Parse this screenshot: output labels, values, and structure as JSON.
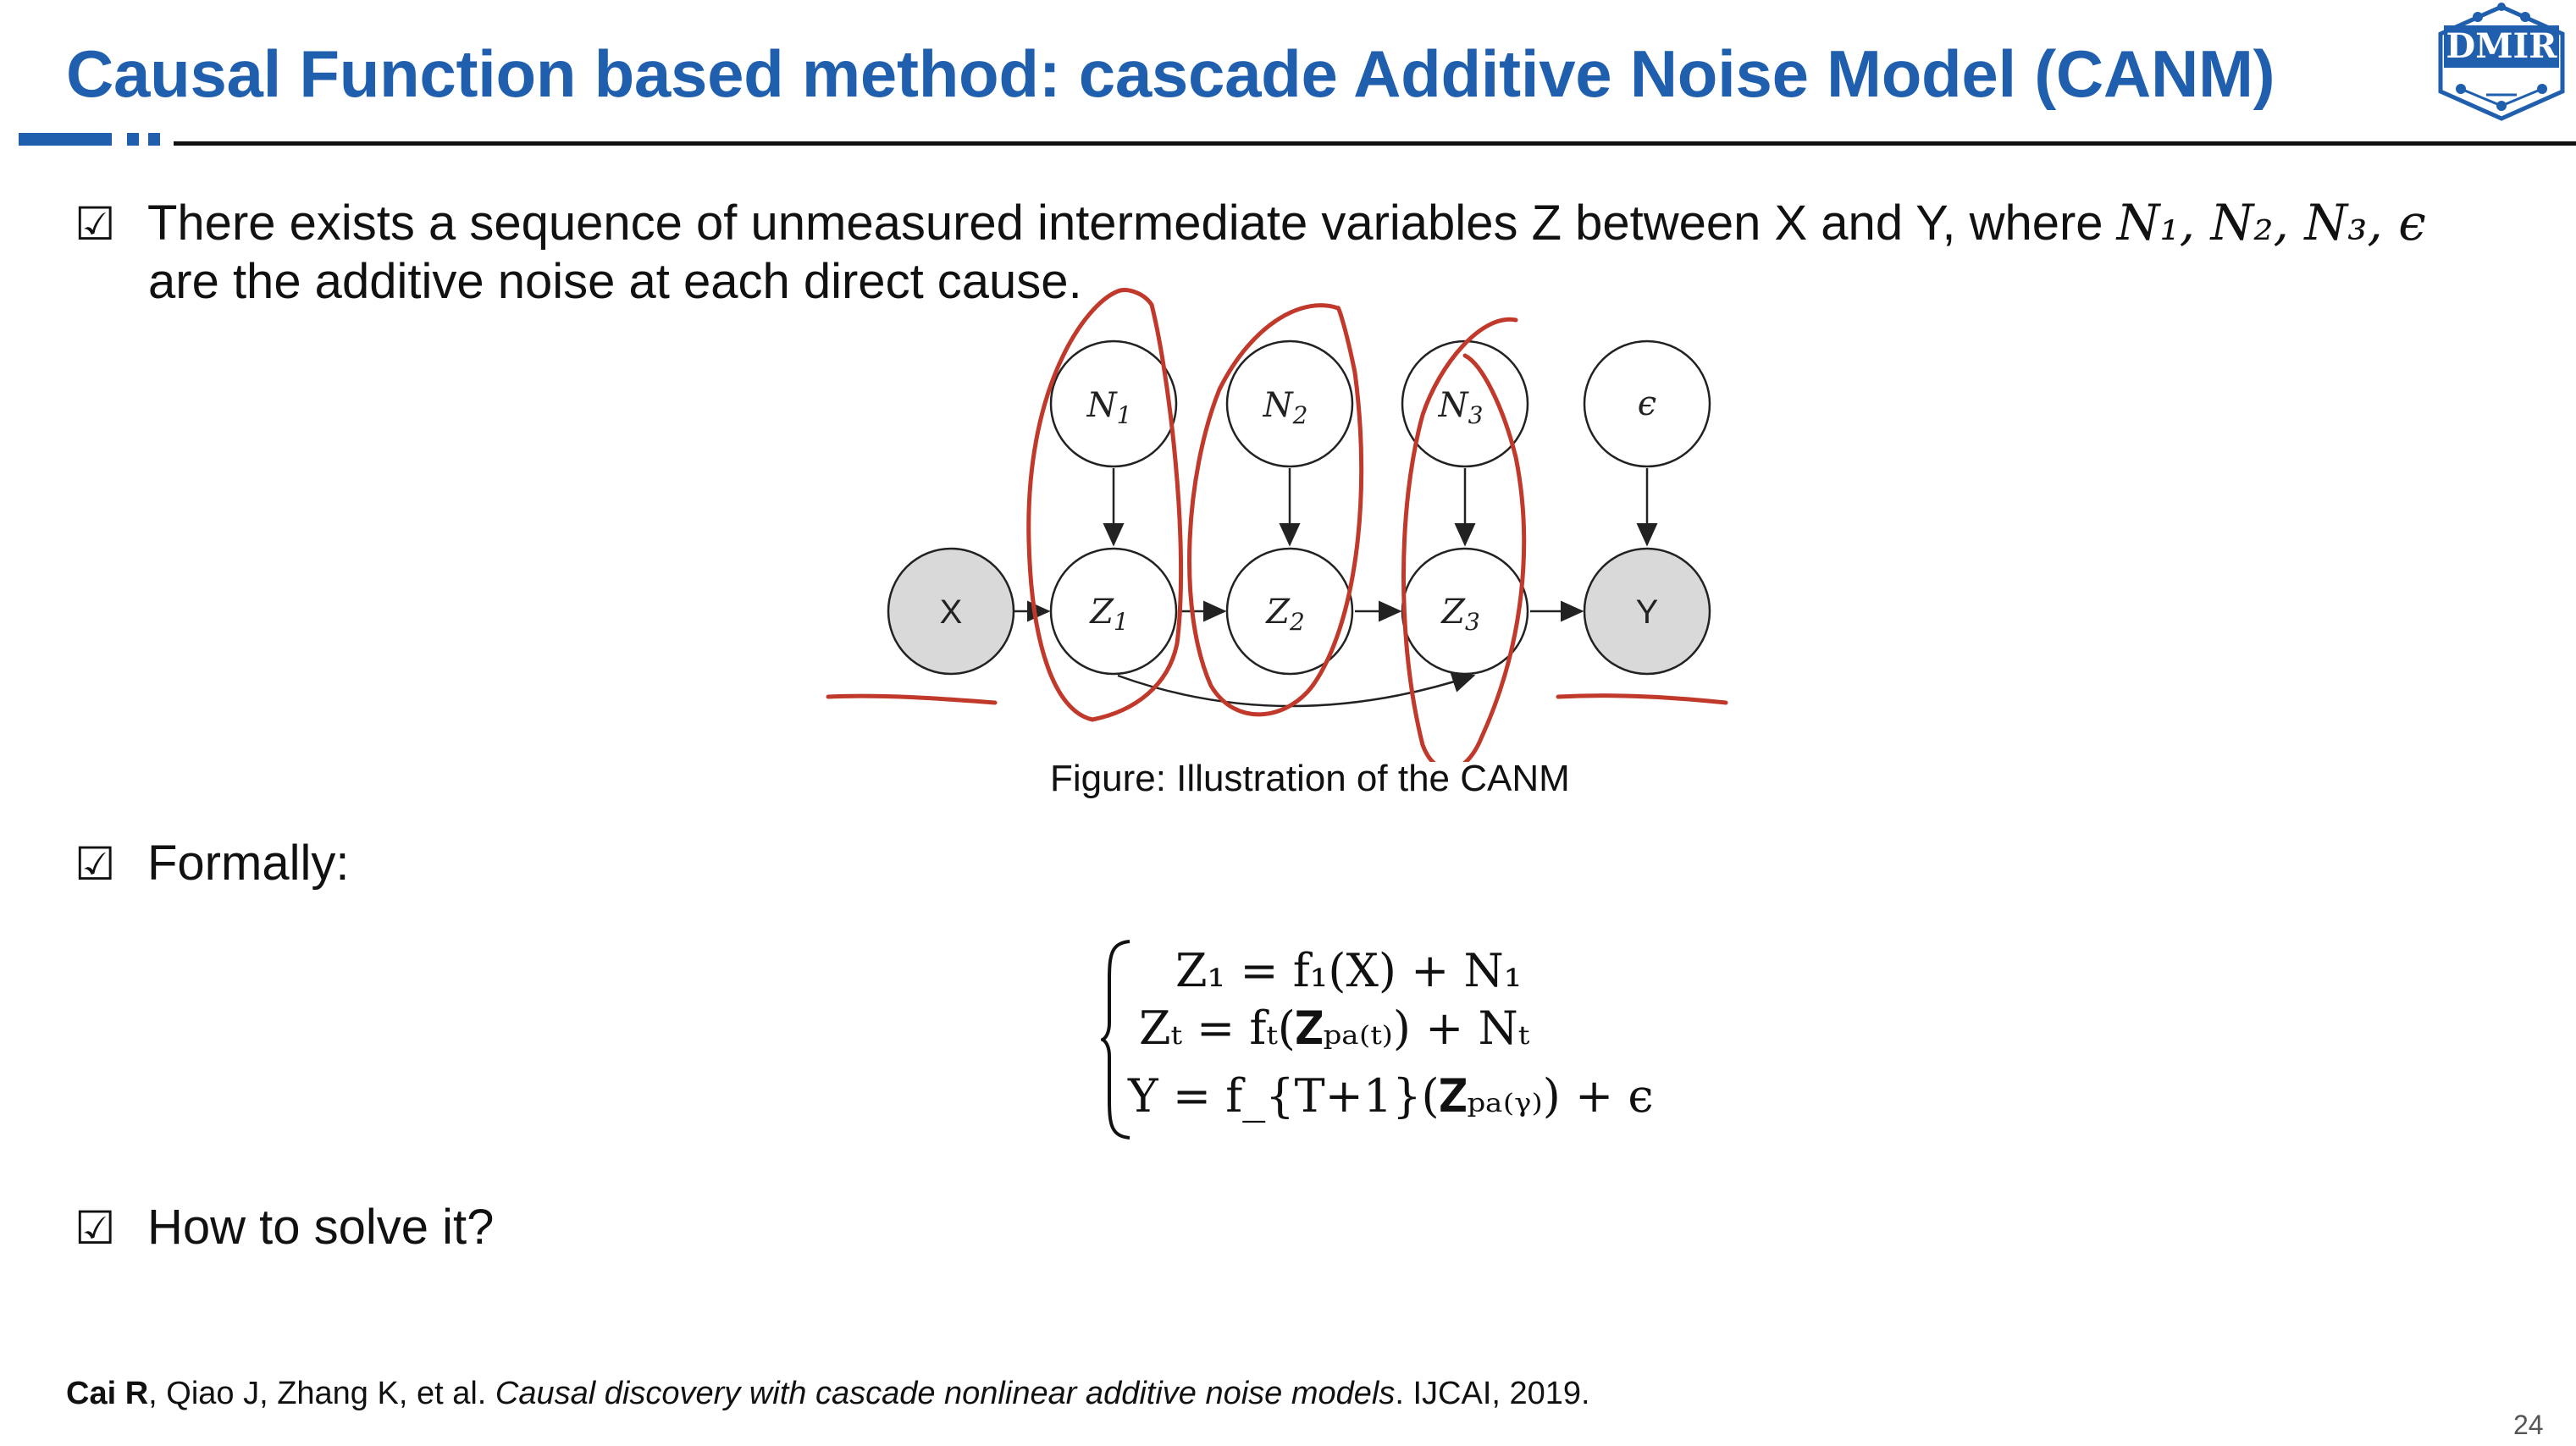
{
  "slide": {
    "title": "Causal Function based method: cascade Additive Noise Model (CANM)",
    "logo_text": "DMIR",
    "page_number": "24"
  },
  "bullets": [
    {
      "check": "☑",
      "line1": "There exists a sequence of unmeasured intermediate variables Z  between X and Y, where ",
      "line1_math": "N₁, N₂, N₃, ϵ",
      "line2": "are the additive noise at each direct cause."
    },
    {
      "check": "☑",
      "text": "Formally:"
    },
    {
      "check": "☑",
      "text": "How to solve it?"
    }
  ],
  "figure": {
    "caption": "Figure: Illustration of the CANM",
    "nodes": {
      "x": "X",
      "y": "Y",
      "n1": "N",
      "n1_sub": "1",
      "n2": "N",
      "n2_sub": "2",
      "n3": "N",
      "n3_sub": "3",
      "eps": "ϵ",
      "z1": "Z",
      "z1_sub": "1",
      "z2": "Z",
      "z2_sub": "2",
      "z3": "Z",
      "z3_sub": "3"
    },
    "colors": {
      "node_fill_observed": "#d9d9d9",
      "annotation": "#c0392b"
    }
  },
  "equations": [
    "Z₁ = f₁(X) + N₁",
    "Zₜ = fₜ(𝐙ₚₐ₍ₜ₎) + Nₜ",
    "Y = f_{T+1}(𝐙ₚₐ₍ᵧ₎) + ϵ"
  ],
  "reference": {
    "authors_bold": "Cai R",
    "authors_rest": ", Qiao J, Zhang K, et al. ",
    "title_italic": "Causal discovery with cascade nonlinear additive noise models",
    "venue": ". IJCAI, 2019."
  },
  "theme": {
    "accent": "#1f5fae"
  }
}
